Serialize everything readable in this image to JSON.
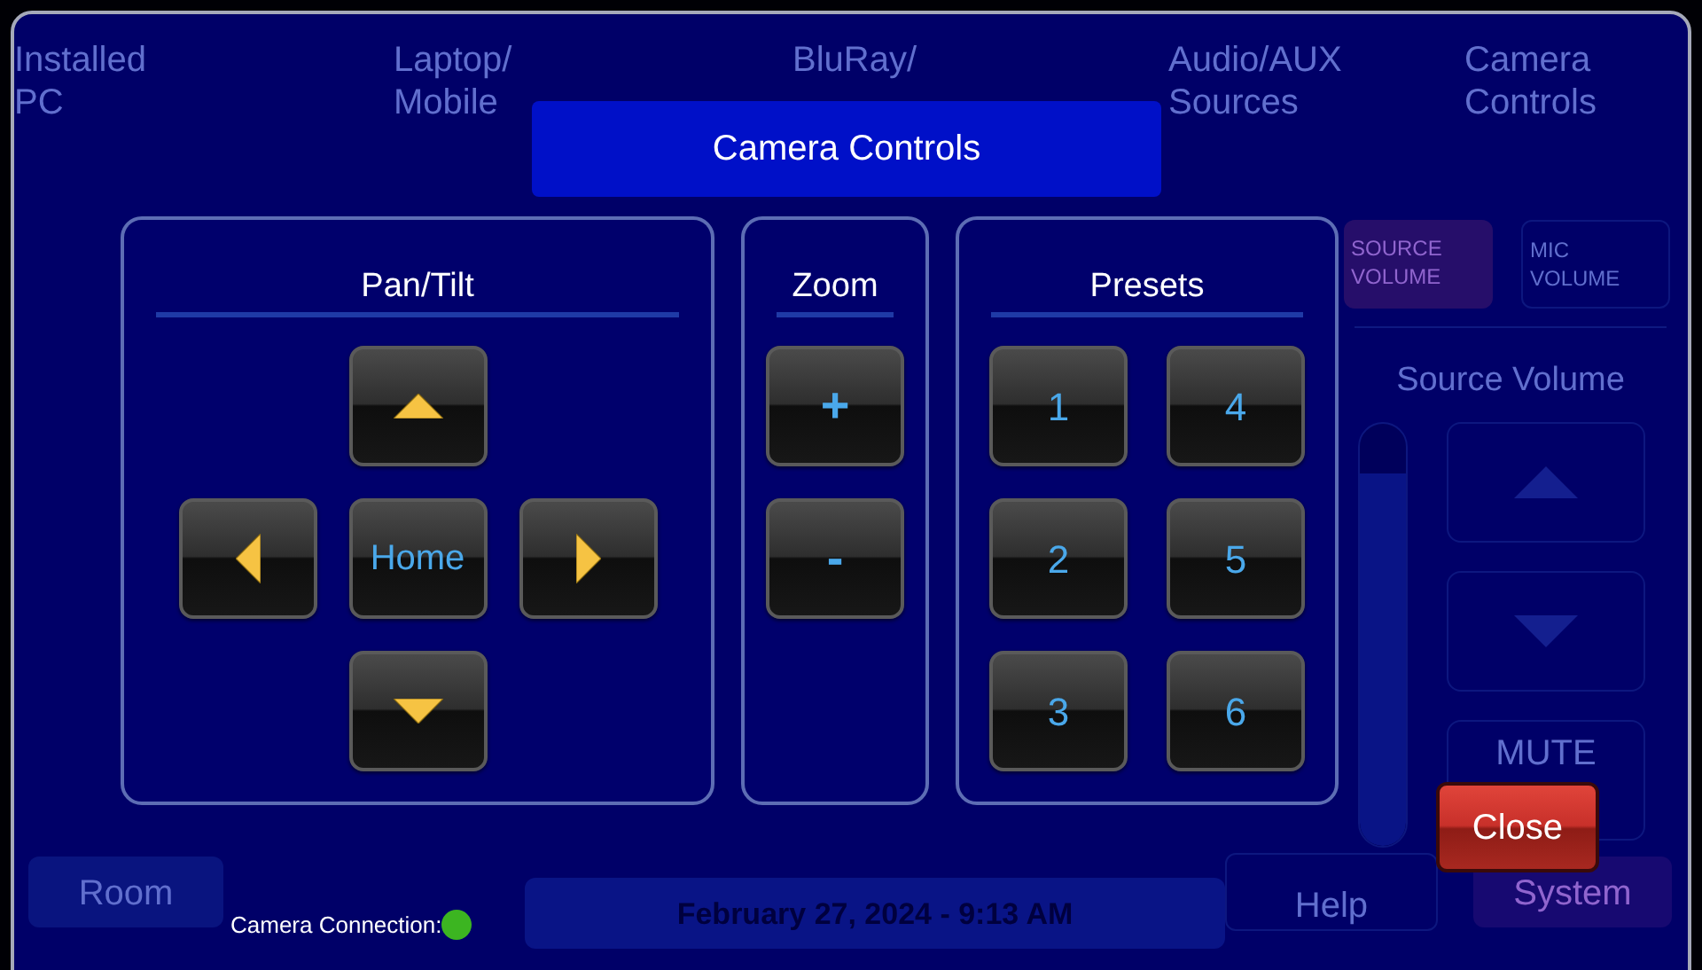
{
  "background": {
    "nav_items": [
      {
        "label": "Installed\nPC"
      },
      {
        "label": "Laptop/\nMobile"
      },
      {
        "label": "BluRay/"
      },
      {
        "label": "Audio/AUX\nSources"
      },
      {
        "label": "Camera\nControls"
      }
    ],
    "volume_tabs": [
      {
        "label": "SOURCE\nVOLUME",
        "selected": true
      },
      {
        "label": "MIC\nVOLUME",
        "selected": false
      }
    ],
    "volume": {
      "title": "Source Volume",
      "level": 0.88,
      "mute": "MUTE"
    },
    "bottom_bar": {
      "room": "Room",
      "date": "February 27, 2024  -  9:13 AM",
      "help": "Help",
      "system": "System"
    }
  },
  "modal": {
    "title": "Camera Controls",
    "pan_tilt": {
      "title": "Pan/Tilt",
      "home": "Home"
    },
    "zoom": {
      "title": "Zoom",
      "buttons": [
        "+",
        "-"
      ]
    },
    "presets": {
      "title": "Presets",
      "buttons": [
        "1",
        "2",
        "3",
        "4",
        "5",
        "6"
      ]
    },
    "close": "Close",
    "status": {
      "label": "Camera Connection:",
      "connected": true
    }
  }
}
